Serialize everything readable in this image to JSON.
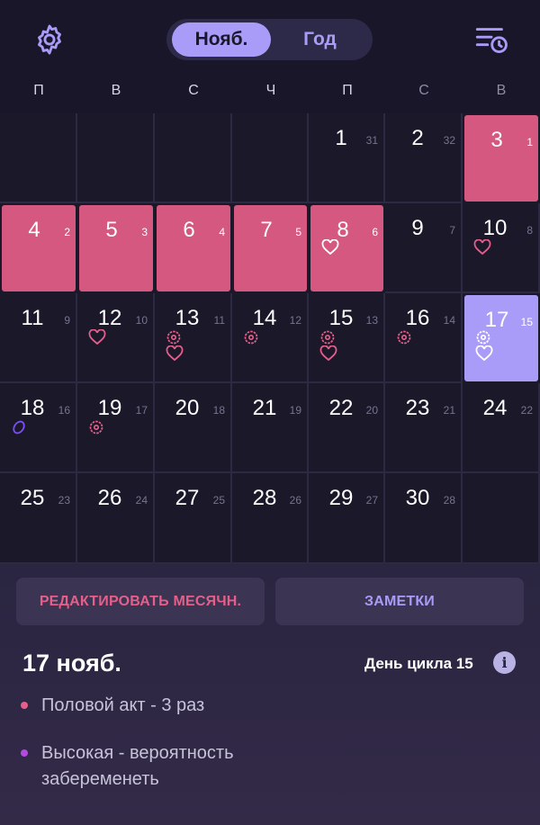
{
  "header": {
    "settings_icon": "gear-icon",
    "history_icon": "list-clock-icon",
    "tabs": [
      {
        "label": "Нояб.",
        "active": true
      },
      {
        "label": "Год",
        "active": false
      }
    ]
  },
  "colors": {
    "background": "#181628",
    "period": "#d4587f",
    "selected": "#a99cf8",
    "accent_pink": "#e55f8a",
    "accent_purple": "#a99cf8",
    "ovulation_icon": "#7d4cff"
  },
  "weekdays": [
    "П",
    "В",
    "С",
    "Ч",
    "П",
    "С",
    "В"
  ],
  "calendar": {
    "rows": [
      [
        null,
        null,
        null,
        null,
        {
          "day": "1",
          "cycle": "31"
        },
        {
          "day": "2",
          "cycle": "32"
        },
        {
          "day": "3",
          "cycle": "1",
          "state": "period"
        }
      ],
      [
        {
          "day": "4",
          "cycle": "2",
          "state": "period"
        },
        {
          "day": "5",
          "cycle": "3",
          "state": "period"
        },
        {
          "day": "6",
          "cycle": "4",
          "state": "period"
        },
        {
          "day": "7",
          "cycle": "5",
          "state": "period"
        },
        {
          "day": "8",
          "cycle": "6",
          "state": "period",
          "icons": [
            "heart-icon"
          ]
        },
        {
          "day": "9",
          "cycle": "7"
        },
        {
          "day": "10",
          "cycle": "8",
          "icons": [
            "heart-icon"
          ]
        }
      ],
      [
        {
          "day": "11",
          "cycle": "9"
        },
        {
          "day": "12",
          "cycle": "10",
          "icons": [
            "heart-icon"
          ]
        },
        {
          "day": "13",
          "cycle": "11",
          "icons": [
            "flower-icon",
            "heart-icon"
          ]
        },
        {
          "day": "14",
          "cycle": "12",
          "icons": [
            "flower-icon"
          ]
        },
        {
          "day": "15",
          "cycle": "13",
          "icons": [
            "flower-icon",
            "heart-icon"
          ]
        },
        {
          "day": "16",
          "cycle": "14",
          "icons": [
            "flower-icon"
          ]
        },
        {
          "day": "17",
          "cycle": "15",
          "state": "selected",
          "icons": [
            "flower-icon",
            "heart-icon"
          ]
        }
      ],
      [
        {
          "day": "18",
          "cycle": "16",
          "icons": [
            "egg-icon"
          ]
        },
        {
          "day": "19",
          "cycle": "17",
          "icons": [
            "flower-icon"
          ]
        },
        {
          "day": "20",
          "cycle": "18"
        },
        {
          "day": "21",
          "cycle": "19"
        },
        {
          "day": "22",
          "cycle": "20"
        },
        {
          "day": "23",
          "cycle": "21"
        },
        {
          "day": "24",
          "cycle": "22"
        }
      ],
      [
        {
          "day": "25",
          "cycle": "23"
        },
        {
          "day": "26",
          "cycle": "24"
        },
        {
          "day": "27",
          "cycle": "25"
        },
        {
          "day": "28",
          "cycle": "26"
        },
        {
          "day": "29",
          "cycle": "27"
        },
        {
          "day": "30",
          "cycle": "28"
        },
        null
      ]
    ]
  },
  "actions": {
    "edit_label": "РЕДАКТИРОВАТЬ МЕСЯЧН.",
    "notes_label": "ЗАМЕТКИ"
  },
  "details": {
    "date": "17 нояб.",
    "cycle_day": "День цикла 15",
    "info_icon": "info-icon",
    "info_glyph": "i",
    "notes": [
      {
        "text": "Половой акт - 3 раз",
        "color": "#e55f8a"
      },
      {
        "text": "Высокая - вероятность забеременеть",
        "color": "#b44be0"
      }
    ]
  }
}
